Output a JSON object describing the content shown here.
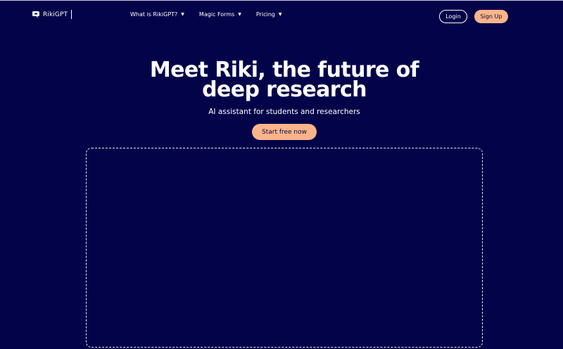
{
  "brand": {
    "name": "RikiGPT",
    "logo_icon": "riki-logo-icon"
  },
  "nav": {
    "items": [
      {
        "label": "What is RikiGPT?",
        "chevron": "▼"
      },
      {
        "label": "Magic Forms",
        "chevron": "▼"
      },
      {
        "label": "Pricing",
        "chevron": "▼"
      }
    ],
    "login_label": "Login",
    "signup_label": "Sign Up"
  },
  "hero": {
    "title_line1": "Meet Riki, the future of",
    "title_line2": "deep research",
    "subtitle": "AI assistant for students and researchers",
    "cta_label": "Start free now"
  },
  "colors": {
    "background": "#03034a",
    "accent": "#fbb48a",
    "text": "#ffffff"
  }
}
